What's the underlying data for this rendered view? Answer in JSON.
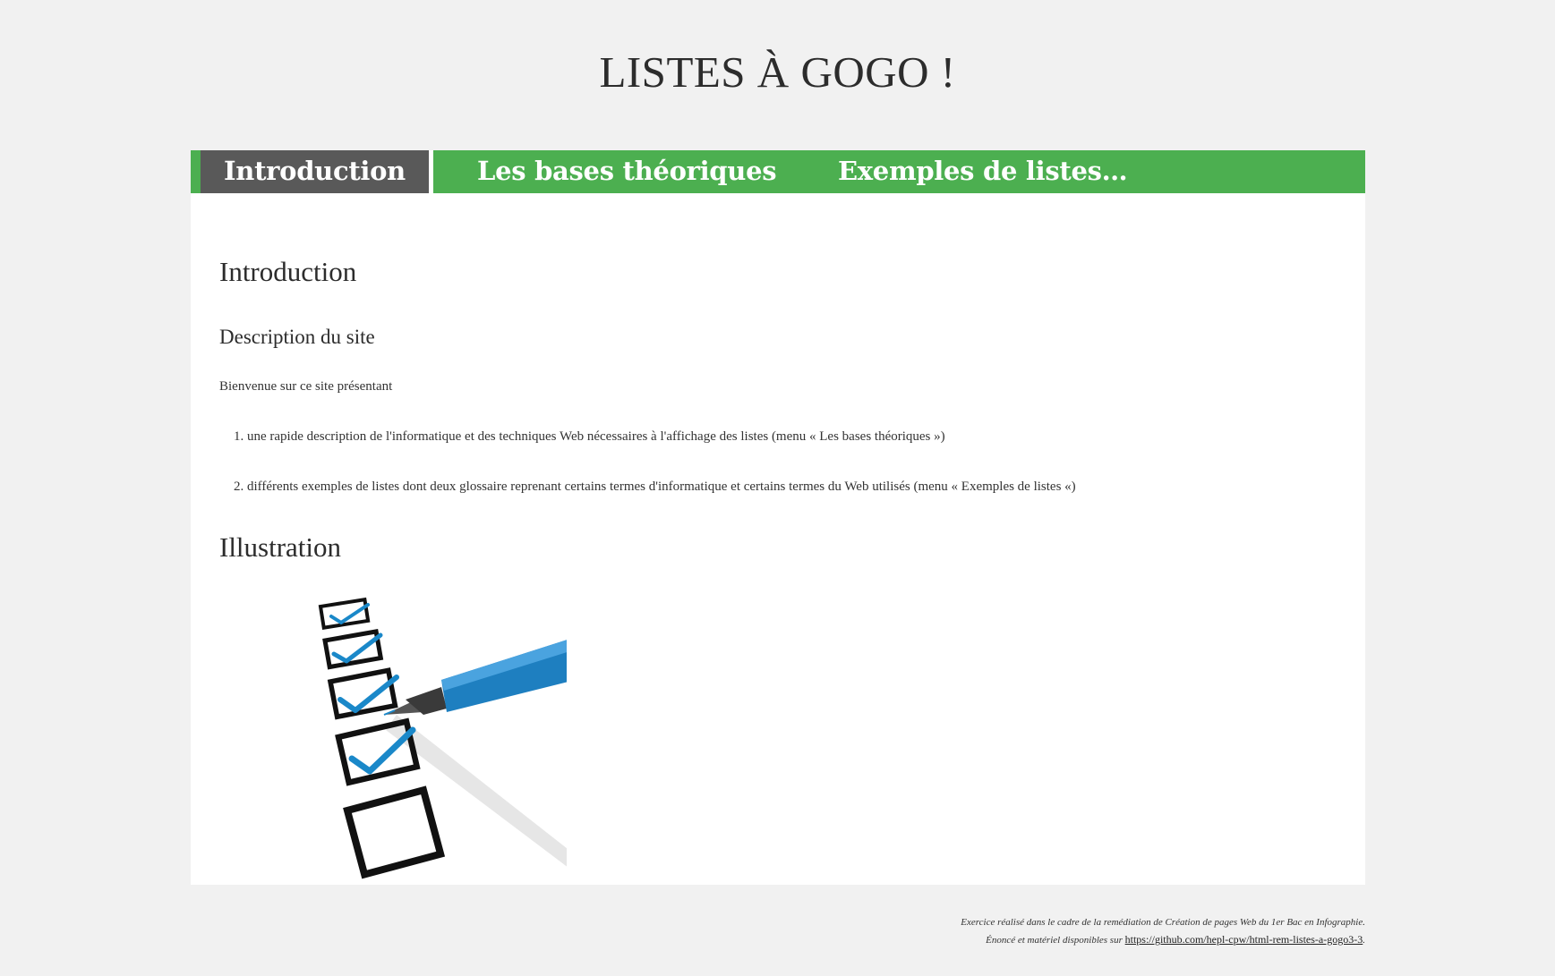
{
  "header": {
    "title": "LISTES À GOGO !"
  },
  "nav": {
    "items": [
      {
        "label": "Introduction",
        "active": true
      },
      {
        "label": "Les bases théoriques",
        "active": false
      },
      {
        "label": "Exemples de listes…",
        "active": false
      }
    ]
  },
  "main": {
    "heading": "Introduction",
    "subheading": "Description du site",
    "intro_text": "Bienvenue sur ce site présentant",
    "list": [
      {
        "number": "1.",
        "text": "une rapide description de l'informatique et des techniques Web nécessaires à l'affichage des listes (menu « Les bases théoriques »)"
      },
      {
        "number": "2.",
        "text": "différents exemples de listes dont deux glossaire reprenant certains termes d'informatique et certains termes du Web utilisés (menu « Exemples de listes «)"
      }
    ],
    "illustration_heading": "Illustration",
    "illustration": {
      "icon": "checklist-pen-illustration",
      "checkbox_color": "#1a88c9",
      "pen_color": "#1e7fc0"
    }
  },
  "footer": {
    "line1": "Exercice réalisé dans le cadre de la remédiation de Création de pages Web du 1er Bac en Infographie.",
    "line2_prefix": "Énoncé et matériel disponibles sur",
    "link": "https://github.com/hepl-cpw/html-rem-listes-a-gogo3-3",
    "line2_suffix": "."
  },
  "colors": {
    "background": "#f1f1f1",
    "nav_bar": "#4caf50",
    "nav_active": "#595959",
    "content_bg": "#ffffff"
  }
}
